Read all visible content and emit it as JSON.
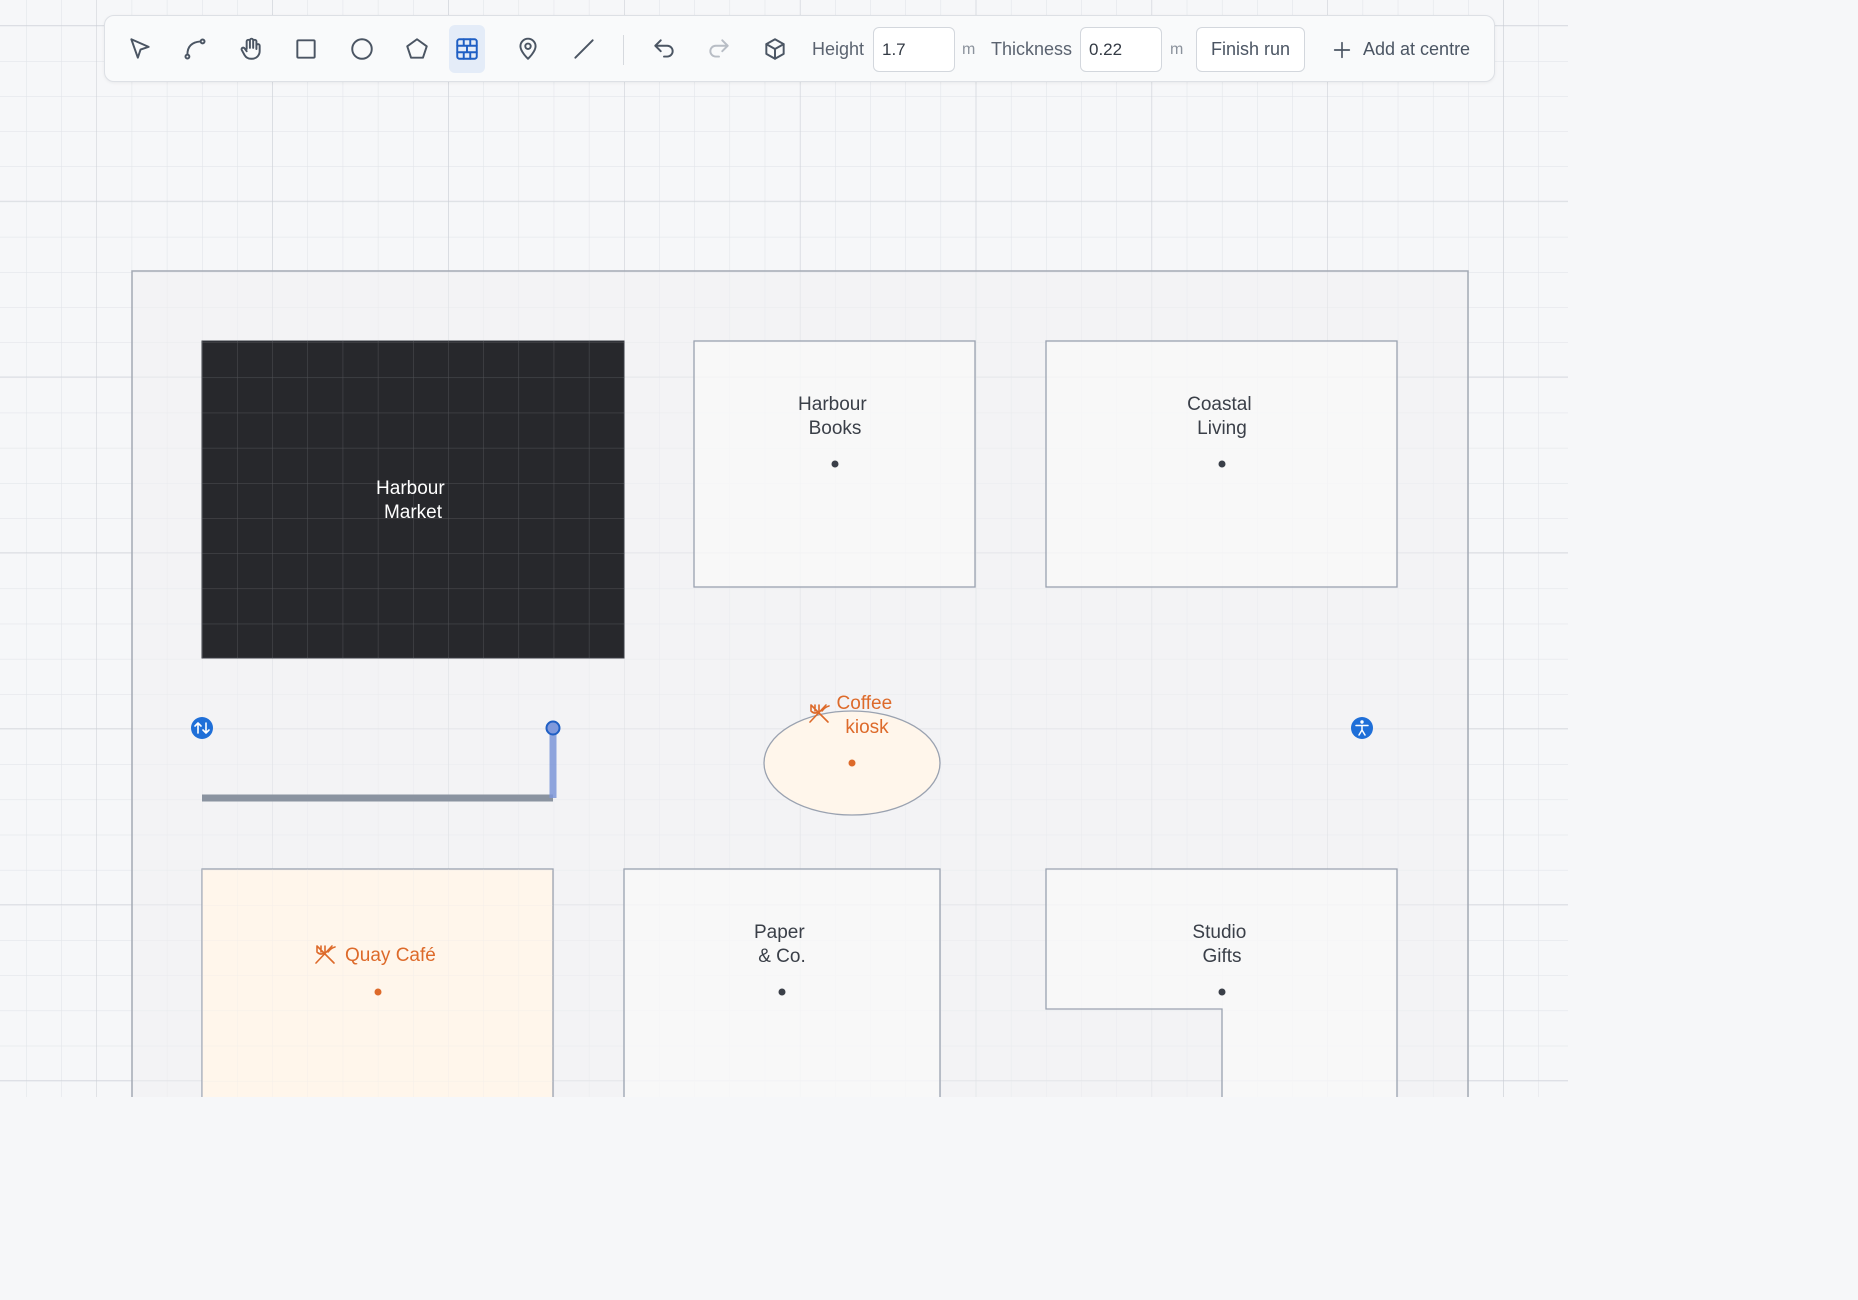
{
  "toolbar": {
    "tools": [
      {
        "name": "select-tool-button",
        "icon": "pointer-icon",
        "active": false
      },
      {
        "name": "path-tool-button",
        "icon": "bezier-curve-icon",
        "active": false
      },
      {
        "name": "pan-tool-button",
        "icon": "hand-icon",
        "active": false
      },
      {
        "name": "rectangle-tool-button",
        "icon": "square-icon",
        "active": false
      },
      {
        "name": "ellipse-tool-button",
        "icon": "circle-icon",
        "active": false
      },
      {
        "name": "polygon-tool-button",
        "icon": "pentagon-icon",
        "active": false
      },
      {
        "name": "wall-tool-button",
        "icon": "brick-wall-icon",
        "active": true
      },
      {
        "name": "marker-tool-button",
        "icon": "map-pin-icon",
        "active": false
      },
      {
        "name": "line-tool-button",
        "icon": "diagonal-line-icon",
        "active": false
      },
      {
        "name": "undo-button",
        "icon": "undo-icon",
        "active": false
      },
      {
        "name": "redo-button",
        "icon": "redo-icon",
        "active": false,
        "disabled": true
      },
      {
        "name": "3d-view-button",
        "icon": "cube-icon",
        "active": false
      }
    ],
    "height_label": "Height",
    "height_value": "1.7",
    "height_unit": "m",
    "thickness_label": "Thickness",
    "thickness_value": "0.22",
    "thickness_unit": "m",
    "finish_run_label": "Finish run",
    "add_at_centre_label": "Add at centre"
  },
  "floor_plan": {
    "units": [
      {
        "id": "harbour-market",
        "lines": [
          "Harbour",
          "Market"
        ],
        "selected": true,
        "kind": "store"
      },
      {
        "id": "harbour-books",
        "lines": [
          "Harbour",
          "Books"
        ],
        "selected": false,
        "kind": "store"
      },
      {
        "id": "coastal-living",
        "lines": [
          "Coastal",
          "Living"
        ],
        "selected": false,
        "kind": "store"
      },
      {
        "id": "coffee-kiosk",
        "lines": [
          "Coffee",
          "kiosk"
        ],
        "selected": false,
        "kind": "food"
      },
      {
        "id": "quay-cafe",
        "lines": [
          "Quay Café"
        ],
        "selected": false,
        "kind": "food"
      },
      {
        "id": "paper-and-co",
        "lines": [
          "Paper",
          "& Co."
        ],
        "selected": false,
        "kind": "store"
      },
      {
        "id": "studio-gifts",
        "lines": [
          "Studio",
          "Gifts"
        ],
        "selected": false,
        "kind": "store"
      }
    ],
    "amenities": [
      {
        "id": "escalator",
        "icon": "escalator-icon"
      },
      {
        "id": "accessible",
        "icon": "accessibility-icon"
      }
    ],
    "colors": {
      "selected_fill": "#27282c",
      "store_fill": "#fafaf9",
      "food_fill": "#fff6eb",
      "food_accent": "#dd6a2a",
      "outline": "#9aa2b0",
      "amenity_blue": "#1f6fd8",
      "wall_color": "#8a93a0",
      "wall_active": "#7b95d8"
    }
  }
}
